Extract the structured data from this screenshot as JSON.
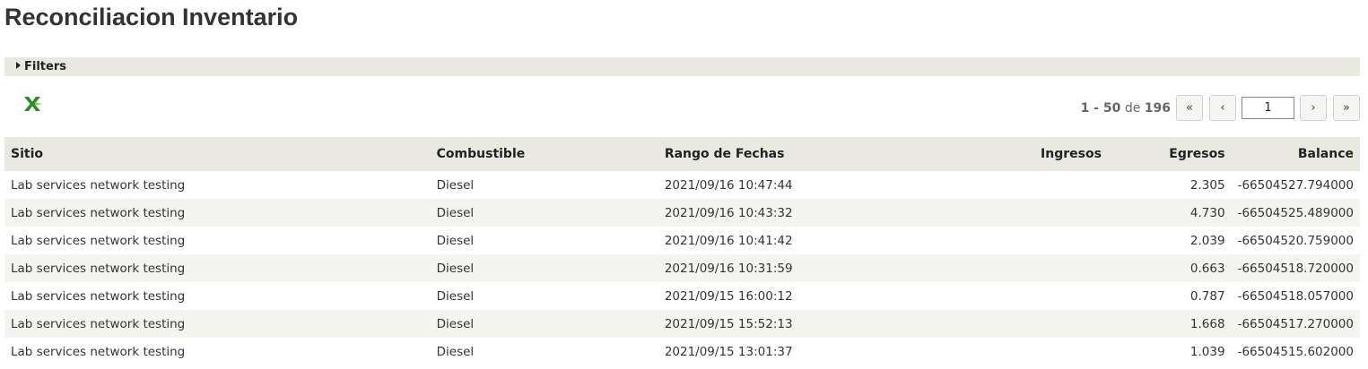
{
  "page": {
    "title": "Reconciliacion Inventario"
  },
  "filters": {
    "label": "Filters"
  },
  "toolbar": {
    "export_icon": "excel-export-icon"
  },
  "pager": {
    "range": "1 - 50",
    "of_word": "de",
    "total": "196",
    "current_page": "1",
    "first_label": "«",
    "prev_label": "‹",
    "next_label": "›",
    "last_label": "»"
  },
  "table": {
    "columns": [
      "Sitio",
      "Combustible",
      "Rango de Fechas",
      "Ingresos",
      "Egresos",
      "Balance"
    ],
    "rows": [
      [
        "Lab services network testing",
        "Diesel",
        "2021/09/16 10:47:44",
        "",
        "2.305",
        "-66504527.794000"
      ],
      [
        "Lab services network testing",
        "Diesel",
        "2021/09/16 10:43:32",
        "",
        "4.730",
        "-66504525.489000"
      ],
      [
        "Lab services network testing",
        "Diesel",
        "2021/09/16 10:41:42",
        "",
        "2.039",
        "-66504520.759000"
      ],
      [
        "Lab services network testing",
        "Diesel",
        "2021/09/16 10:31:59",
        "",
        "0.663",
        "-66504518.720000"
      ],
      [
        "Lab services network testing",
        "Diesel",
        "2021/09/15 16:00:12",
        "",
        "0.787",
        "-66504518.057000"
      ],
      [
        "Lab services network testing",
        "Diesel",
        "2021/09/15 15:52:13",
        "",
        "1.668",
        "-66504517.270000"
      ],
      [
        "Lab services network testing",
        "Diesel",
        "2021/09/15 13:01:37",
        "",
        "1.039",
        "-66504515.602000"
      ]
    ]
  }
}
